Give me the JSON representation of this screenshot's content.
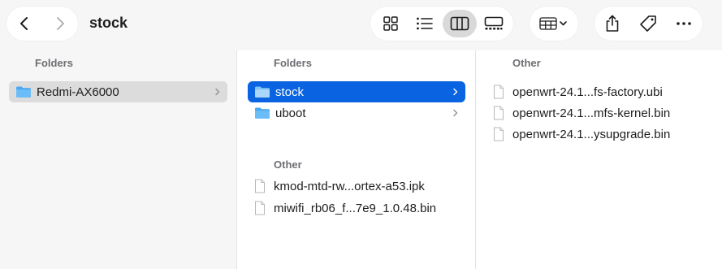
{
  "window": {
    "title": "stock"
  },
  "toolbar": {
    "nav": {
      "back_icon": "chevron-left-icon",
      "forward_icon": "chevron-right-icon"
    },
    "view_modes": [
      {
        "name": "icons",
        "icon": "grid-view-icon",
        "active": false
      },
      {
        "name": "list",
        "icon": "list-view-icon",
        "active": false
      },
      {
        "name": "columns",
        "icon": "column-view-icon",
        "active": true
      },
      {
        "name": "gallery",
        "icon": "gallery-view-icon",
        "active": false
      }
    ],
    "group_icon": "group-by-icon",
    "actions": [
      {
        "name": "share",
        "icon": "share-icon"
      },
      {
        "name": "tag",
        "icon": "tag-icon"
      },
      {
        "name": "more",
        "icon": "more-icon"
      }
    ]
  },
  "columns": [
    {
      "sections": [
        {
          "header": "Folders",
          "items": [
            {
              "label": "Redmi-AX6000",
              "type": "folder",
              "selected": "gray",
              "has_children": true
            }
          ]
        }
      ]
    },
    {
      "sections": [
        {
          "header": "Folders",
          "items": [
            {
              "label": "stock",
              "type": "folder",
              "selected": "blue",
              "has_children": true
            },
            {
              "label": "uboot",
              "type": "folder",
              "selected": "none",
              "has_children": true
            }
          ]
        },
        {
          "header": "Other",
          "items": [
            {
              "label": "kmod-mtd-rw...ortex-a53.ipk",
              "type": "file"
            },
            {
              "label": "miwifi_rb06_f...7e9_1.0.48.bin",
              "type": "file"
            }
          ]
        }
      ]
    },
    {
      "sections": [
        {
          "header": "Other",
          "items": [
            {
              "label": "openwrt-24.1...fs-factory.ubi",
              "type": "file"
            },
            {
              "label": "openwrt-24.1...mfs-kernel.bin",
              "type": "file"
            },
            {
              "label": "openwrt-24.1...ysupgrade.bin",
              "type": "file"
            }
          ]
        }
      ]
    }
  ],
  "colors": {
    "accent": "#0a63e0",
    "folder": "#4ba7f2",
    "selected_gray": "#dcdcdc",
    "section_header": "#6e6e73"
  }
}
